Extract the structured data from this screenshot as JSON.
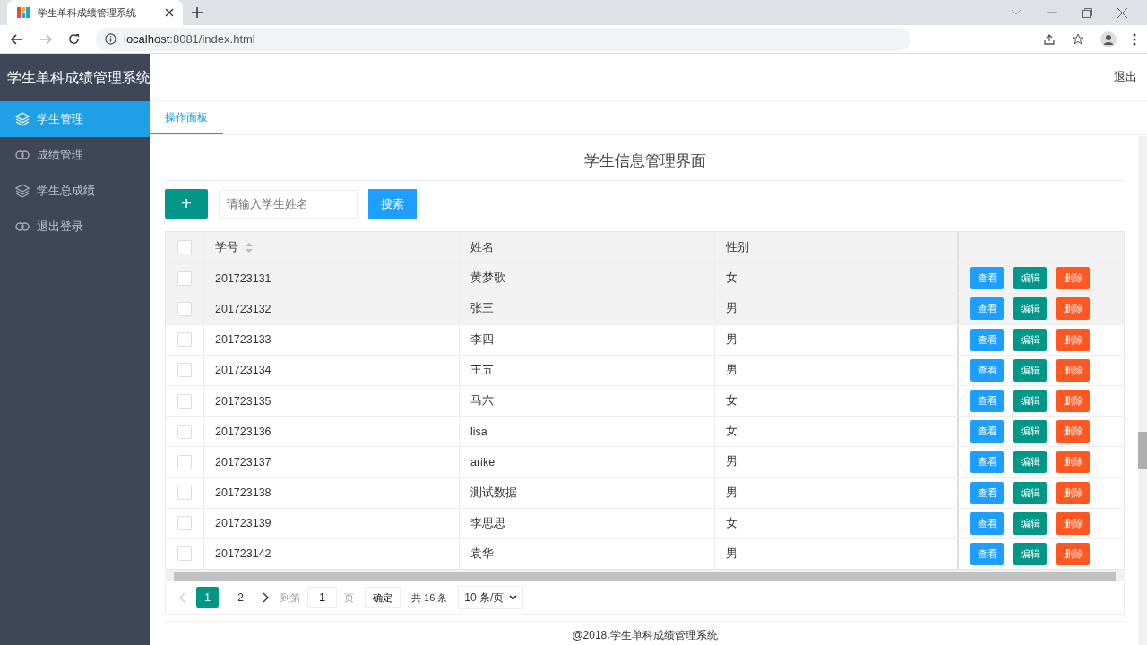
{
  "browser": {
    "tab_title": "学生单科成绩管理系统",
    "url_host": "localhost",
    "url_rest": ":8081/index.html"
  },
  "sidebar": {
    "title": "学生单科成绩管理系统",
    "items": [
      {
        "label": "学生管理",
        "kind": "layers",
        "selected": true
      },
      {
        "label": "成绩管理",
        "kind": "link",
        "selected": false
      },
      {
        "label": "学生总成绩",
        "kind": "layers",
        "selected": false
      },
      {
        "label": "退出登录",
        "kind": "link",
        "selected": false
      }
    ]
  },
  "header": {
    "logout": "退出"
  },
  "tabs": [
    {
      "label": "操作面板",
      "selected": true
    }
  ],
  "page_title": "学生信息管理界面",
  "toolbar": {
    "add": "+",
    "search_placeholder": "请输入学生姓名",
    "search_button": "搜索"
  },
  "table": {
    "all_checked": false,
    "columns": [
      {
        "label": "学号",
        "sortable": true
      },
      {
        "label": "姓名",
        "sortable": false
      },
      {
        "label": "性别",
        "sortable": false
      }
    ],
    "rows": [
      {
        "checked": false,
        "highlighted": true,
        "cells": [
          "201723131",
          "黄梦歌",
          "女"
        ],
        "actions": [
          {
            "label": "查看",
            "kind": "view"
          },
          {
            "label": "编辑",
            "kind": "edit"
          },
          {
            "label": "删除",
            "kind": "delete"
          }
        ]
      },
      {
        "checked": false,
        "highlighted": true,
        "cells": [
          "201723132",
          "张三",
          "男"
        ],
        "actions": [
          {
            "label": "查看",
            "kind": "view"
          },
          {
            "label": "编辑",
            "kind": "edit"
          },
          {
            "label": "删除",
            "kind": "delete"
          }
        ]
      },
      {
        "checked": false,
        "highlighted": false,
        "cells": [
          "201723133",
          "李四",
          "男"
        ],
        "actions": [
          {
            "label": "查看",
            "kind": "view"
          },
          {
            "label": "编辑",
            "kind": "edit"
          },
          {
            "label": "删除",
            "kind": "delete"
          }
        ]
      },
      {
        "checked": false,
        "highlighted": false,
        "cells": [
          "201723134",
          "王五",
          "男"
        ],
        "actions": [
          {
            "label": "查看",
            "kind": "view"
          },
          {
            "label": "编辑",
            "kind": "edit"
          },
          {
            "label": "删除",
            "kind": "delete"
          }
        ]
      },
      {
        "checked": false,
        "highlighted": false,
        "cells": [
          "201723135",
          "马六",
          "女"
        ],
        "actions": [
          {
            "label": "查看",
            "kind": "view"
          },
          {
            "label": "编辑",
            "kind": "edit"
          },
          {
            "label": "删除",
            "kind": "delete"
          }
        ]
      },
      {
        "checked": false,
        "highlighted": false,
        "cells": [
          "201723136",
          "lisa",
          "女"
        ],
        "actions": [
          {
            "label": "查看",
            "kind": "view"
          },
          {
            "label": "编辑",
            "kind": "edit"
          },
          {
            "label": "删除",
            "kind": "delete"
          }
        ]
      },
      {
        "checked": false,
        "highlighted": false,
        "cells": [
          "201723137",
          "arike",
          "男"
        ],
        "actions": [
          {
            "label": "查看",
            "kind": "view"
          },
          {
            "label": "编辑",
            "kind": "edit"
          },
          {
            "label": "删除",
            "kind": "delete"
          }
        ]
      },
      {
        "checked": false,
        "highlighted": false,
        "cells": [
          "201723138",
          "测试数据",
          "男"
        ],
        "actions": [
          {
            "label": "查看",
            "kind": "view"
          },
          {
            "label": "编辑",
            "kind": "edit"
          },
          {
            "label": "删除",
            "kind": "delete"
          }
        ]
      },
      {
        "checked": false,
        "highlighted": false,
        "cells": [
          "201723139",
          "李思思",
          "女"
        ],
        "actions": [
          {
            "label": "查看",
            "kind": "view"
          },
          {
            "label": "编辑",
            "kind": "edit"
          },
          {
            "label": "删除",
            "kind": "delete"
          }
        ]
      },
      {
        "checked": false,
        "highlighted": false,
        "cells": [
          "201723142",
          "袁华",
          "男"
        ],
        "actions": [
          {
            "label": "查看",
            "kind": "view"
          },
          {
            "label": "编辑",
            "kind": "edit"
          },
          {
            "label": "删除",
            "kind": "delete"
          }
        ]
      }
    ]
  },
  "pagination": {
    "pages": [
      {
        "label": "1",
        "selected": true
      },
      {
        "label": "2",
        "selected": false
      }
    ],
    "goto_label": "到第",
    "goto_value": "1",
    "page_unit": "页",
    "confirm": "确定",
    "total": "共 16 条",
    "page_size": "10 条/页"
  },
  "footer": "@2018.学生单科成绩管理系统"
}
